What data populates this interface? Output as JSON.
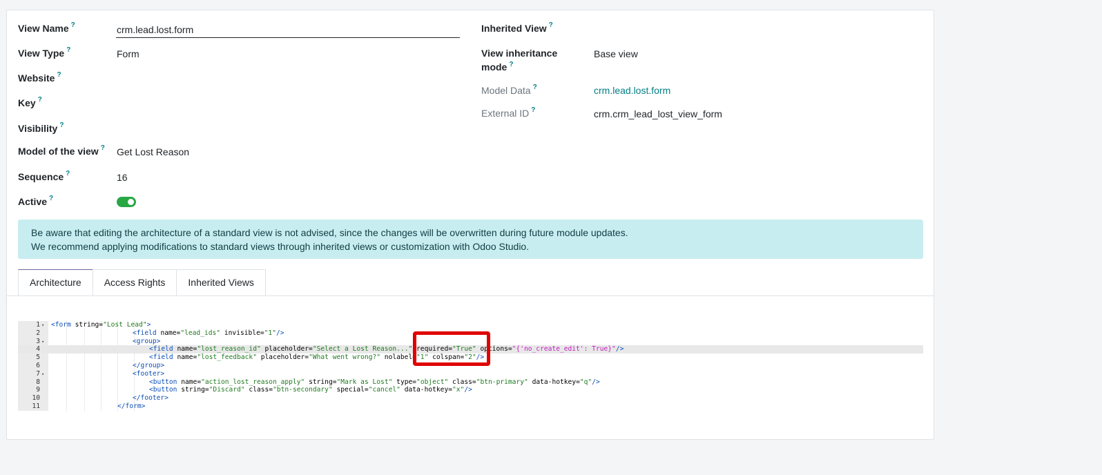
{
  "form": {
    "left_fields": [
      {
        "label": "View Name",
        "help": "?",
        "value": ""
      },
      {
        "label": "View Type",
        "help": "?",
        "value": "Form"
      },
      {
        "label": "Website",
        "help": "?",
        "value": ""
      },
      {
        "label": "Key",
        "help": "?",
        "value": ""
      },
      {
        "label": "Visibility",
        "help": "?",
        "value": ""
      },
      {
        "label": "Model of the view",
        "help": "?",
        "value": "Get Lost Reason"
      },
      {
        "label": "Sequence",
        "help": "?",
        "value": "16"
      },
      {
        "label": "Active",
        "help": "?",
        "value": ""
      }
    ],
    "view_name_value": "crm.lead.lost.form",
    "active_on": true,
    "right_fields": [
      {
        "label": "Inherited View",
        "help": "?",
        "value": ""
      },
      {
        "label_line1": "View inheritance",
        "label_line2": "mode",
        "help": "?",
        "value": "Base view"
      },
      {
        "label": "Model Data",
        "help": "?",
        "value": "crm.lead.lost.form"
      },
      {
        "label": "External ID",
        "help": "?",
        "value": "crm.crm_lead_lost_view_form"
      }
    ]
  },
  "alert": {
    "line1": "Be aware that editing the architecture of a standard view is not advised, since the changes will be overwritten during future module updates.",
    "line2": "We recommend applying modifications to standard views through inherited views or customization with Odoo Studio."
  },
  "tabs": [
    {
      "label": "Architecture",
      "active": true
    },
    {
      "label": "Access Rights",
      "active": false
    },
    {
      "label": "Inherited Views",
      "active": false
    }
  ],
  "editor": {
    "line_numbers": [
      "1",
      "2",
      "3",
      "4",
      "5",
      "6",
      "7",
      "8",
      "9",
      "10",
      "11"
    ],
    "fold_marker": "▾",
    "active_line": 4,
    "lines": [
      [
        [
          "t",
          "<form "
        ],
        [
          "a",
          "string="
        ],
        [
          "s",
          "\"Lost Lead\""
        ],
        [
          "t",
          ">"
        ]
      ],
      [
        [
          "t",
          "<field "
        ],
        [
          "a",
          "name="
        ],
        [
          "s",
          "\"lead_ids\""
        ],
        [
          "a",
          " invisible="
        ],
        [
          "s",
          "\"1\""
        ],
        [
          "t",
          "/>"
        ]
      ],
      [
        [
          "t",
          "<group>"
        ]
      ],
      [
        [
          "t",
          "<field "
        ],
        [
          "a",
          "name="
        ],
        [
          "s",
          "\"lost_reason_id\""
        ],
        [
          "a",
          " placeholder="
        ],
        [
          "s",
          "\"Select a Lost Reason...\""
        ],
        [
          "a",
          " required="
        ],
        [
          "s",
          "\"True\""
        ],
        [
          "a",
          " options="
        ],
        [
          "p",
          "\"{'no_create_edit': True}\""
        ],
        [
          "t",
          "/>"
        ]
      ],
      [
        [
          "t",
          "<field "
        ],
        [
          "a",
          "name="
        ],
        [
          "s",
          "\"lost_feedback\""
        ],
        [
          "a",
          " placeholder="
        ],
        [
          "s",
          "\"What went wrong?\""
        ],
        [
          "a",
          " nolabel="
        ],
        [
          "s",
          "\"1\""
        ],
        [
          "a",
          " colspan="
        ],
        [
          "s",
          "\"2\""
        ],
        [
          "t",
          "/>"
        ]
      ],
      [
        [
          "t",
          "</group>"
        ]
      ],
      [
        [
          "t",
          "<footer>"
        ]
      ],
      [
        [
          "t",
          "<button "
        ],
        [
          "a",
          "name="
        ],
        [
          "s",
          "\"action_lost_reason_apply\""
        ],
        [
          "a",
          " string="
        ],
        [
          "s",
          "\"Mark as Lost\""
        ],
        [
          "a",
          " type="
        ],
        [
          "s",
          "\"object\""
        ],
        [
          "a",
          " class="
        ],
        [
          "s",
          "\"btn-primary\""
        ],
        [
          "a",
          " data-hotkey="
        ],
        [
          "s",
          "\"q\""
        ],
        [
          "t",
          "/>"
        ]
      ],
      [
        [
          "t",
          "<button "
        ],
        [
          "a",
          "string="
        ],
        [
          "s",
          "\"Discard\""
        ],
        [
          "a",
          " class="
        ],
        [
          "s",
          "\"btn-secondary\""
        ],
        [
          "a",
          " special="
        ],
        [
          "s",
          "\"cancel\""
        ],
        [
          "a",
          " data-hotkey="
        ],
        [
          "s",
          "\"x\""
        ],
        [
          "t",
          "/>"
        ]
      ],
      [
        [
          "t",
          "</footer>"
        ]
      ],
      [
        [
          "t",
          "</form>"
        ]
      ]
    ]
  },
  "colors": {
    "accent": "#017e84",
    "toggle_on": "#28a745",
    "alert_bg": "#c8edf0",
    "highlight_box": "#e00000"
  }
}
